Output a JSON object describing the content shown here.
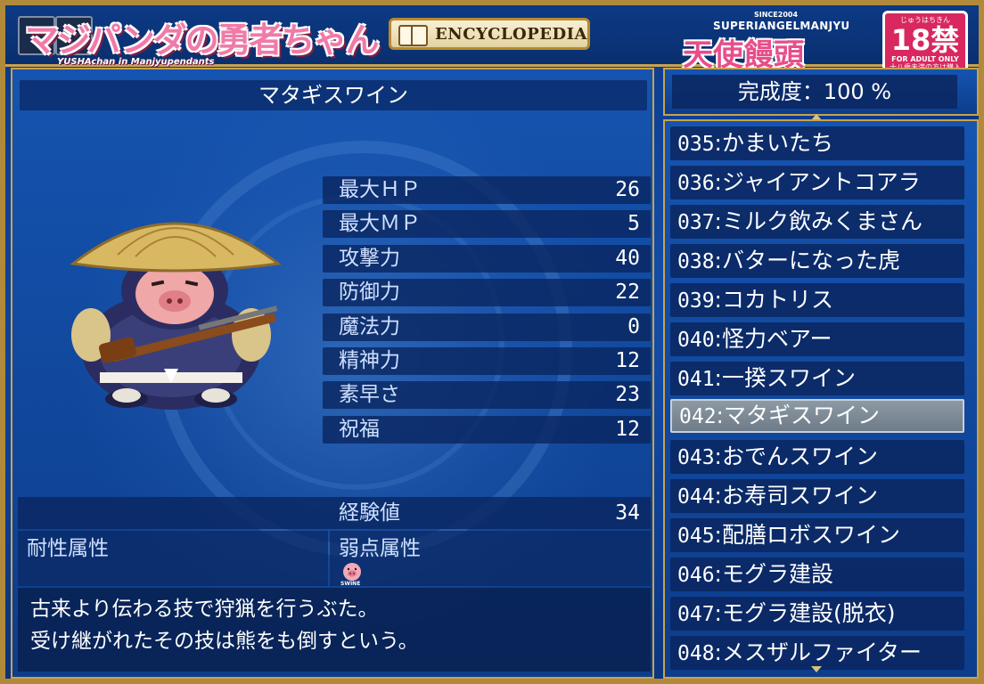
{
  "header": {
    "title_jp": "マジパンダの勇者ちゃん",
    "title_en": "YUSHAchan in Manjyupendants",
    "encyclopedia_label": "ENCYCLOPEDIA",
    "brand_since": "SINCE2004",
    "brand_en": "SUPERIANGELMANJYU",
    "brand_jp": "天使饅頭",
    "age_top": "じゅうはちきん",
    "age_rating": "18禁",
    "age_adult": "FOR ADULT ONLY",
    "age_note": "十八歳未満の方は購入できません。"
  },
  "monster": {
    "name": "マタギスワイン",
    "stats": [
      {
        "label": "最大ＨＰ",
        "value": "26"
      },
      {
        "label": "最大ＭＰ",
        "value": "5"
      },
      {
        "label": "攻撃力",
        "value": "40"
      },
      {
        "label": "防御力",
        "value": "22"
      },
      {
        "label": "魔法力",
        "value": "0"
      },
      {
        "label": "精神力",
        "value": "12"
      },
      {
        "label": "素早さ",
        "value": "23"
      },
      {
        "label": "祝福",
        "value": "12"
      }
    ],
    "exp_label": "経験値",
    "exp_value": "34",
    "resist_label": "耐性属性",
    "weak_label": "弱点属性",
    "weak_icon_label": "SWINE",
    "description_1": "古来より伝わる技で狩猟を行うぶた。",
    "description_2": "受け継がれたその技は熊をも倒すという。"
  },
  "completion": {
    "label": "完成度：100 %"
  },
  "list": [
    {
      "num": "035",
      "name": ":かまいたち"
    },
    {
      "num": "036",
      "name": ":ジャイアントコアラ"
    },
    {
      "num": "037",
      "name": ":ミルク飲みくまさん"
    },
    {
      "num": "038",
      "name": ":バターになった虎"
    },
    {
      "num": "039",
      "name": ":コカトリス"
    },
    {
      "num": "040",
      "name": ":怪力ベアー"
    },
    {
      "num": "041",
      "name": ":一揆スワイン"
    },
    {
      "num": "042",
      "name": ":マタギスワイン"
    },
    {
      "num": "043",
      "name": ":おでんスワイン"
    },
    {
      "num": "044",
      "name": ":お寿司スワイン"
    },
    {
      "num": "045",
      "name": ":配膳ロボスワイン"
    },
    {
      "num": "046",
      "name": ":モグラ建設"
    },
    {
      "num": "047",
      "name": ":モグラ建設(脱衣)"
    },
    {
      "num": "048",
      "name": ":メスザルファイター"
    }
  ],
  "colors": {
    "frame_gold": "#c9a24e",
    "panel_blue": "#1554b0",
    "selected_gray": "#8d9aa6",
    "title_pink": "#f07aa8"
  }
}
